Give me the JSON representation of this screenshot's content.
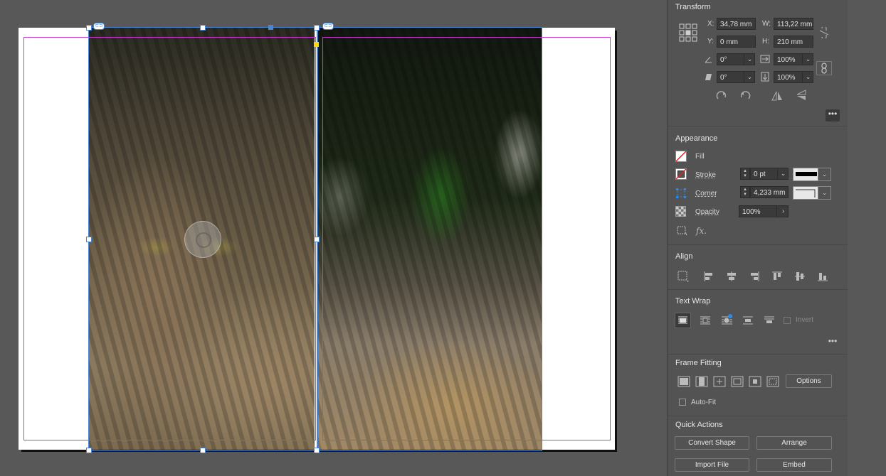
{
  "canvas": {
    "link_badge": "⊂⊃"
  },
  "transform": {
    "title": "Transform",
    "x_label": "X:",
    "x_value": "34,78 mm",
    "y_label": "Y:",
    "y_value": "0 mm",
    "w_label": "W:",
    "w_value": "113,22 mm",
    "h_label": "H:",
    "h_value": "210 mm",
    "rotate_value": "0°",
    "scale_x_value": "100%",
    "shear_value": "0°",
    "scale_y_value": "100%"
  },
  "appearance": {
    "title": "Appearance",
    "fill_label": "Fill",
    "stroke_label": "Stroke",
    "stroke_value": "0 pt",
    "corner_label": "Corner",
    "corner_value": "4,233 mm",
    "opacity_label": "Opacity",
    "opacity_value": "100%",
    "fx_label": "fx."
  },
  "align": {
    "title": "Align"
  },
  "text_wrap": {
    "title": "Text Wrap",
    "invert_label": "Invert"
  },
  "frame_fitting": {
    "title": "Frame Fitting",
    "options_label": "Options",
    "autofit_label": "Auto-Fit"
  },
  "quick_actions": {
    "title": "Quick Actions",
    "convert_shape": "Convert Shape",
    "arrange": "Arrange",
    "import_file": "Import File",
    "embed": "Embed"
  },
  "colors": {
    "panel_bg": "#535353",
    "frame_blue": "#4a86d8",
    "margin_magenta": "#c93bd0",
    "accent_blue": "#2d8ceb"
  }
}
